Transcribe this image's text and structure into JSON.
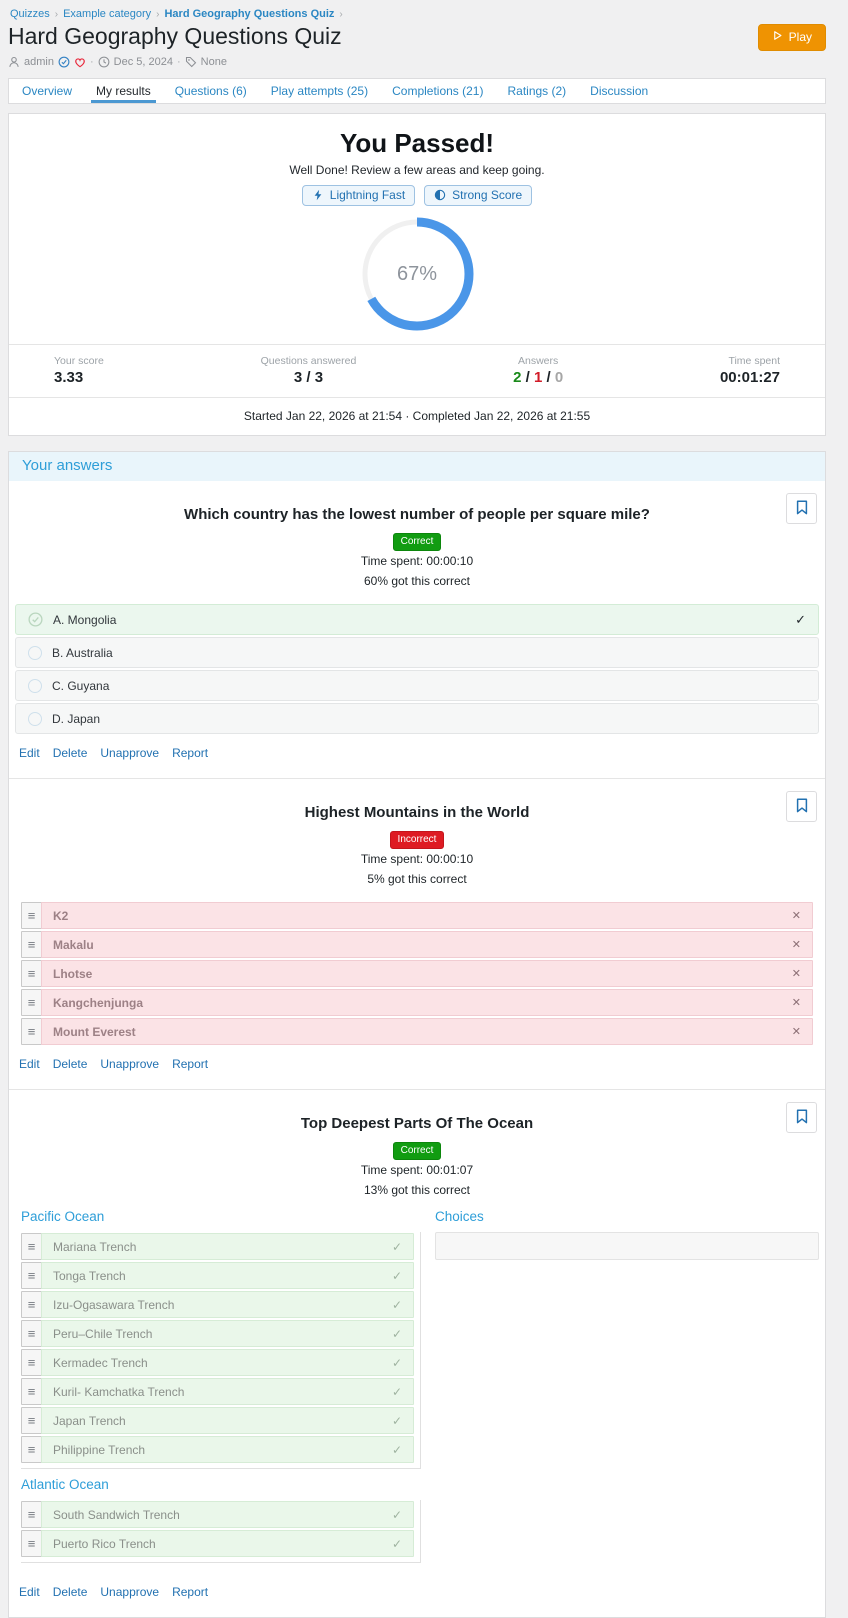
{
  "breadcrumb": {
    "items": [
      "Quizzes",
      "Example category",
      "Hard Geography Questions Quiz"
    ],
    "separator": "›"
  },
  "header": {
    "title": "Hard Geography Questions Quiz",
    "author": "admin",
    "date": "Dec 5, 2024",
    "tags": "None",
    "meta_separator": "·",
    "play_label": "Play"
  },
  "tabs": [
    {
      "label": "Overview",
      "active": false
    },
    {
      "label": "My results",
      "active": true
    },
    {
      "label": "Questions (6)",
      "active": false
    },
    {
      "label": "Play attempts (25)",
      "active": false
    },
    {
      "label": "Completions (21)",
      "active": false
    },
    {
      "label": "Ratings (2)",
      "active": false
    },
    {
      "label": "Discussion",
      "active": false
    }
  ],
  "result": {
    "heading": "You Passed!",
    "subheading": "Well Done! Review a few areas and keep going.",
    "badges": [
      {
        "icon": "lightning-icon",
        "label": "Lightning Fast"
      },
      {
        "icon": "half-circle-icon",
        "label": "Strong Score"
      }
    ],
    "percent_label": "67%",
    "percent_value": 67,
    "stats": [
      {
        "label": "Your score",
        "value": "3.33"
      },
      {
        "label": "Questions answered",
        "value": "3 / 3"
      },
      {
        "label": "Answers",
        "separator": " / ",
        "parts": [
          {
            "text": "2",
            "color": "green"
          },
          {
            "text": "1",
            "color": "red"
          },
          {
            "text": "0",
            "color": "gray"
          }
        ]
      },
      {
        "label": "Time spent",
        "value": "00:01:27"
      }
    ],
    "session": "Started Jan 22, 2026 at 21:54 · Completed Jan 22, 2026 at 21:55"
  },
  "answers_section": {
    "title": "Your answers",
    "questions": [
      {
        "type": "choice",
        "title": "Which country has the lowest number of people per square mile?",
        "status": "Correct",
        "time_spent": "Time spent: 00:00:10",
        "stat": "60% got this correct",
        "options": [
          {
            "label": "A. Mongolia",
            "selected": true
          },
          {
            "label": "B. Australia",
            "selected": false
          },
          {
            "label": "C. Guyana",
            "selected": false
          },
          {
            "label": "D. Japan",
            "selected": false
          }
        ],
        "actions": [
          "Edit",
          "Delete",
          "Unapprove",
          "Report"
        ]
      },
      {
        "type": "ordering",
        "title": "Highest Mountains in the World",
        "status": "Incorrect",
        "time_spent": "Time spent: 00:00:10",
        "stat": "5% got this correct",
        "items": [
          "K2",
          "Makalu",
          "Lhotse",
          "Kangchenjunga",
          "Mount Everest"
        ],
        "actions": [
          "Edit",
          "Delete",
          "Unapprove",
          "Report"
        ]
      },
      {
        "type": "grouping",
        "title": "Top Deepest Parts Of The Ocean",
        "status": "Correct",
        "time_spent": "Time spent: 00:01:07",
        "stat": "13% got this correct",
        "groups": [
          {
            "name": "Pacific Ocean",
            "items": [
              "Mariana Trench",
              "Tonga Trench",
              "Izu-Ogasawara Trench",
              "Peru–Chile Trench",
              "Kermadec Trench",
              "Kuril- Kamchatka Trench",
              "Japan Trench",
              "Philippine Trench"
            ]
          },
          {
            "name": "Atlantic Ocean",
            "items": [
              "South Sandwich Trench",
              "Puerto Rico Trench"
            ]
          }
        ],
        "choices_label": "Choices",
        "choices_items": [],
        "actions": [
          "Edit",
          "Delete",
          "Unapprove",
          "Report"
        ]
      }
    ]
  },
  "colors": {
    "accent_blue": "#2271b1",
    "link_blue": "#2b87c3",
    "heading_blue": "#2e9ed8",
    "success_green": "#119c11",
    "error_red": "#de1b23",
    "play_orange": "#ef9302",
    "donut_blue": "#4a96e8"
  }
}
